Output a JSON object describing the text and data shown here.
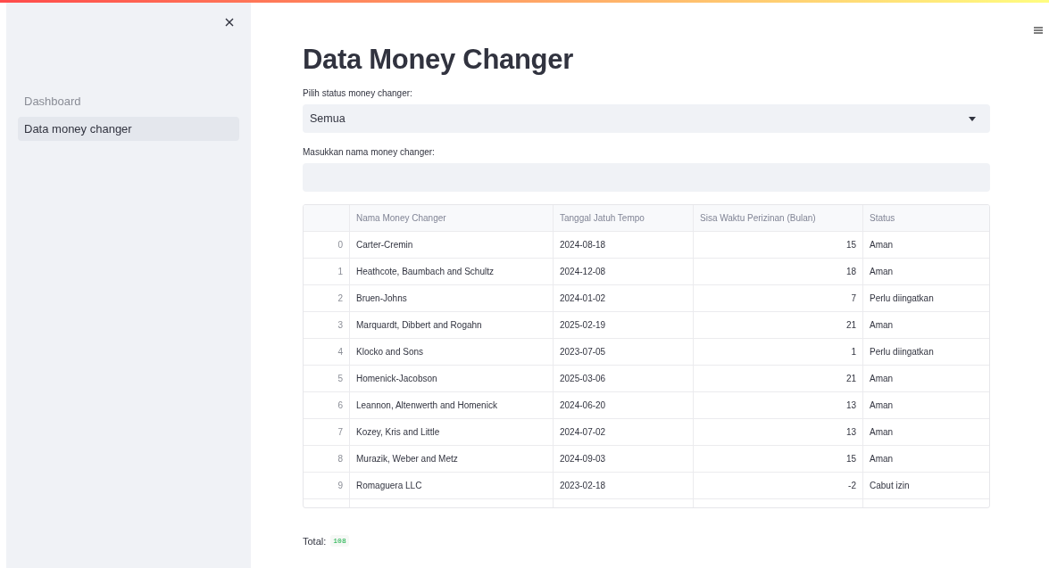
{
  "sidebar": {
    "items": [
      {
        "label": "Dashboard",
        "selected": false
      },
      {
        "label": "Data money changer",
        "selected": true
      }
    ]
  },
  "title": "Data Money Changer",
  "status_select": {
    "label": "Pilih status money changer:",
    "value": "Semua"
  },
  "name_input": {
    "label": "Masukkan nama money changer:"
  },
  "table": {
    "columns": [
      "Nama Money Changer",
      "Tanggal Jatuh Tempo",
      "Sisa Waktu Perizinan (Bulan)",
      "Status"
    ],
    "rows": [
      {
        "index": "0",
        "name": "Carter-Cremin",
        "date": "2024-08-18",
        "months": "15",
        "status": "Aman"
      },
      {
        "index": "1",
        "name": "Heathcote, Baumbach and Schultz",
        "date": "2024-12-08",
        "months": "18",
        "status": "Aman"
      },
      {
        "index": "2",
        "name": "Bruen-Johns",
        "date": "2024-01-02",
        "months": "7",
        "status": "Perlu diingatkan"
      },
      {
        "index": "3",
        "name": "Marquardt, Dibbert and Rogahn",
        "date": "2025-02-19",
        "months": "21",
        "status": "Aman"
      },
      {
        "index": "4",
        "name": "Klocko and Sons",
        "date": "2023-07-05",
        "months": "1",
        "status": "Perlu diingatkan"
      },
      {
        "index": "5",
        "name": "Homenick-Jacobson",
        "date": "2025-03-06",
        "months": "21",
        "status": "Aman"
      },
      {
        "index": "6",
        "name": "Leannon, Altenwerth and Homenick",
        "date": "2024-06-20",
        "months": "13",
        "status": "Aman"
      },
      {
        "index": "7",
        "name": "Kozey, Kris and Little",
        "date": "2024-07-02",
        "months": "13",
        "status": "Aman"
      },
      {
        "index": "8",
        "name": "Murazik, Weber and Metz",
        "date": "2024-09-03",
        "months": "15",
        "status": "Aman"
      },
      {
        "index": "9",
        "name": "Romaguera LLC",
        "date": "2023-02-18",
        "months": "-2",
        "status": "Cabut izin"
      }
    ]
  },
  "total": {
    "label": "Total:",
    "value": "108"
  }
}
